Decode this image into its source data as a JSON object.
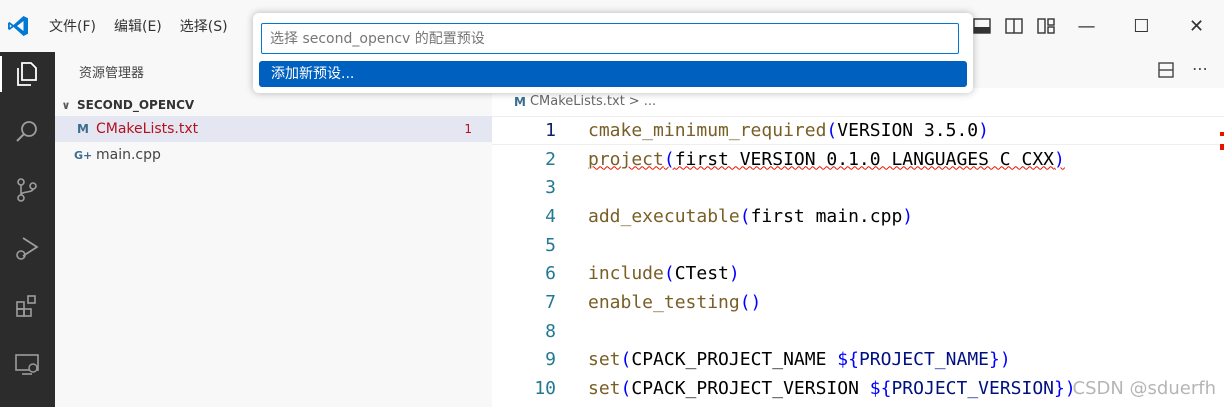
{
  "menu": [
    "文件(F)",
    "编辑(E)",
    "选择(S)"
  ],
  "colors": {
    "accent": "#0078d4",
    "selection": "#0060c0",
    "error": "#e51400",
    "activitybar": "#2c2c2c"
  },
  "sidebar": {
    "title": "资源管理器",
    "folder": "SECOND_OPENCV",
    "files": [
      {
        "icon": "M",
        "name": "CMakeLists.txt",
        "badge": "1",
        "selected": true
      },
      {
        "icon": "G+",
        "name": "main.cpp",
        "badge": "",
        "selected": false
      }
    ]
  },
  "breadcrumb": {
    "file": "CMakeLists.txt",
    "sep": ">",
    "more": "..."
  },
  "code": [
    {
      "n": "1"
    },
    {
      "n": "2"
    },
    {
      "n": "3"
    },
    {
      "n": "4"
    },
    {
      "n": "5"
    },
    {
      "n": "6"
    },
    {
      "n": "7"
    },
    {
      "n": "8"
    },
    {
      "n": "9"
    },
    {
      "n": "10"
    }
  ],
  "code_text": {
    "l1": [
      "cmake_minimum_required",
      "(",
      "VERSION 3.5.0",
      ")"
    ],
    "l2": [
      "project",
      "(",
      "first VERSION 0.1.0 LANGUAGES C CXX",
      ")"
    ],
    "l4": [
      "add_executable",
      "(",
      "first main.cpp",
      ")"
    ],
    "l6": [
      "include",
      "(",
      "CTest",
      ")"
    ],
    "l7": [
      "enable_testing",
      "()"
    ],
    "l9": [
      "set",
      "(",
      "CPACK_PROJECT_NAME ",
      "${",
      "PROJECT_NAME",
      "}",
      ")"
    ],
    "l10": [
      "set",
      "(",
      "CPACK_PROJECT_VERSION ",
      "${",
      "PROJECT_VERSION",
      "}",
      ")"
    ]
  },
  "quickpick": {
    "placeholder": "选择 second_opencv 的配置预设",
    "item": "添加新预设..."
  },
  "watermark": "CSDN @sduerfh",
  "window": {
    "minimize": "—",
    "maximize": "☐",
    "close": "✕"
  }
}
